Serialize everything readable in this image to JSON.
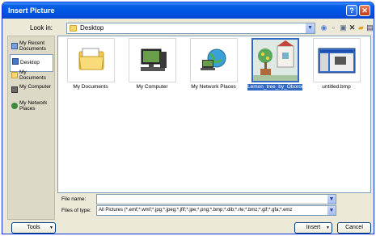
{
  "window": {
    "title": "Insert Picture",
    "help_glyph": "?",
    "close_glyph": "✕"
  },
  "lookin": {
    "label": "Look in:",
    "value": "Desktop"
  },
  "places": [
    {
      "label": "My Recent Documents",
      "icon": "recent-documents-icon"
    },
    {
      "label": "Desktop",
      "icon": "desktop-icon"
    },
    {
      "label": "My Documents",
      "icon": "my-documents-icon"
    },
    {
      "label": "My Computer",
      "icon": "my-computer-icon"
    },
    {
      "label": "My Network Places",
      "icon": "network-places-icon"
    }
  ],
  "files": [
    {
      "name": "My Documents",
      "icon": "folder-icon"
    },
    {
      "name": "My Computer",
      "icon": "computer-icon"
    },
    {
      "name": "My Network Places",
      "icon": "network-icon"
    },
    {
      "name": "Lemon_tree_by_Oborochann.jpg",
      "icon": "image-thumbnail"
    },
    {
      "name": "untitled.bmp",
      "icon": "image-thumbnail"
    }
  ],
  "filename": {
    "label": "File name:",
    "value": ""
  },
  "filetype": {
    "label": "Files of type:",
    "value": "All Pictures (*.emf;*.wmf;*.jpg;*.jpeg;*.jfif;*.jpe;*.png;*.bmp;*.dib;*.rle;*.bmz;*.gif;*.gfa;*.emz"
  },
  "buttons": {
    "tools": "Tools",
    "insert": "Insert",
    "cancel": "Cancel"
  },
  "colors": {
    "title_bar": "#0054e3",
    "dialog_bg": "#ece9d8",
    "selection": "#316ac5"
  }
}
